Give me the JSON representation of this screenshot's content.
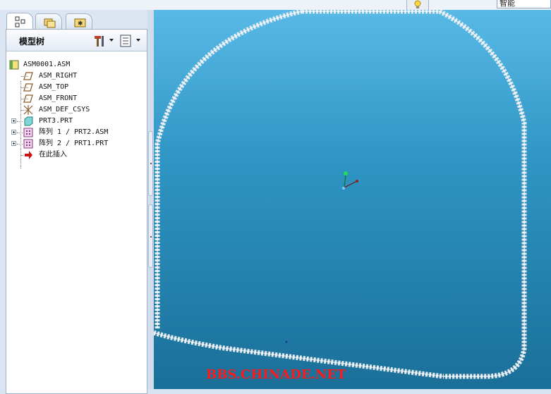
{
  "topbar": {
    "smart_filter": "智能"
  },
  "left_panel": {
    "tabs": [
      {
        "name": "model-tree-tab",
        "icon": "model-tree-icon"
      },
      {
        "name": "folder-browser-tab",
        "icon": "folder-icon"
      },
      {
        "name": "favorites-tab",
        "icon": "favorites-icon"
      }
    ],
    "title": "模型树",
    "tools": {
      "settings_icon": "hammer-wrench-icon",
      "show_icon": "list-icon"
    }
  },
  "tree": {
    "items": [
      {
        "label": "ASM0001.ASM",
        "icon": "assembly-icon"
      },
      {
        "label": "ASM_RIGHT",
        "icon": "datum-plane-icon"
      },
      {
        "label": "ASM_TOP",
        "icon": "datum-plane-icon"
      },
      {
        "label": "ASM_FRONT",
        "icon": "datum-plane-icon"
      },
      {
        "label": "ASM_DEF_CSYS",
        "icon": "csys-icon"
      },
      {
        "label": "PRT3.PRT",
        "icon": "part-icon"
      },
      {
        "label": "阵列 1 / PRT2.ASM",
        "icon": "pattern-icon"
      },
      {
        "label": "阵列 2 / PRT1.PRT",
        "icon": "pattern-icon"
      },
      {
        "label": "在此插入",
        "icon": "insert-here-arrow-icon"
      }
    ]
  },
  "viewport": {
    "watermark": "BBS.CHINADE.NET"
  },
  "colors": {
    "background_top": "#58b9e6",
    "background_bottom": "#1a6f98",
    "watermark": "#ff1a1a"
  }
}
